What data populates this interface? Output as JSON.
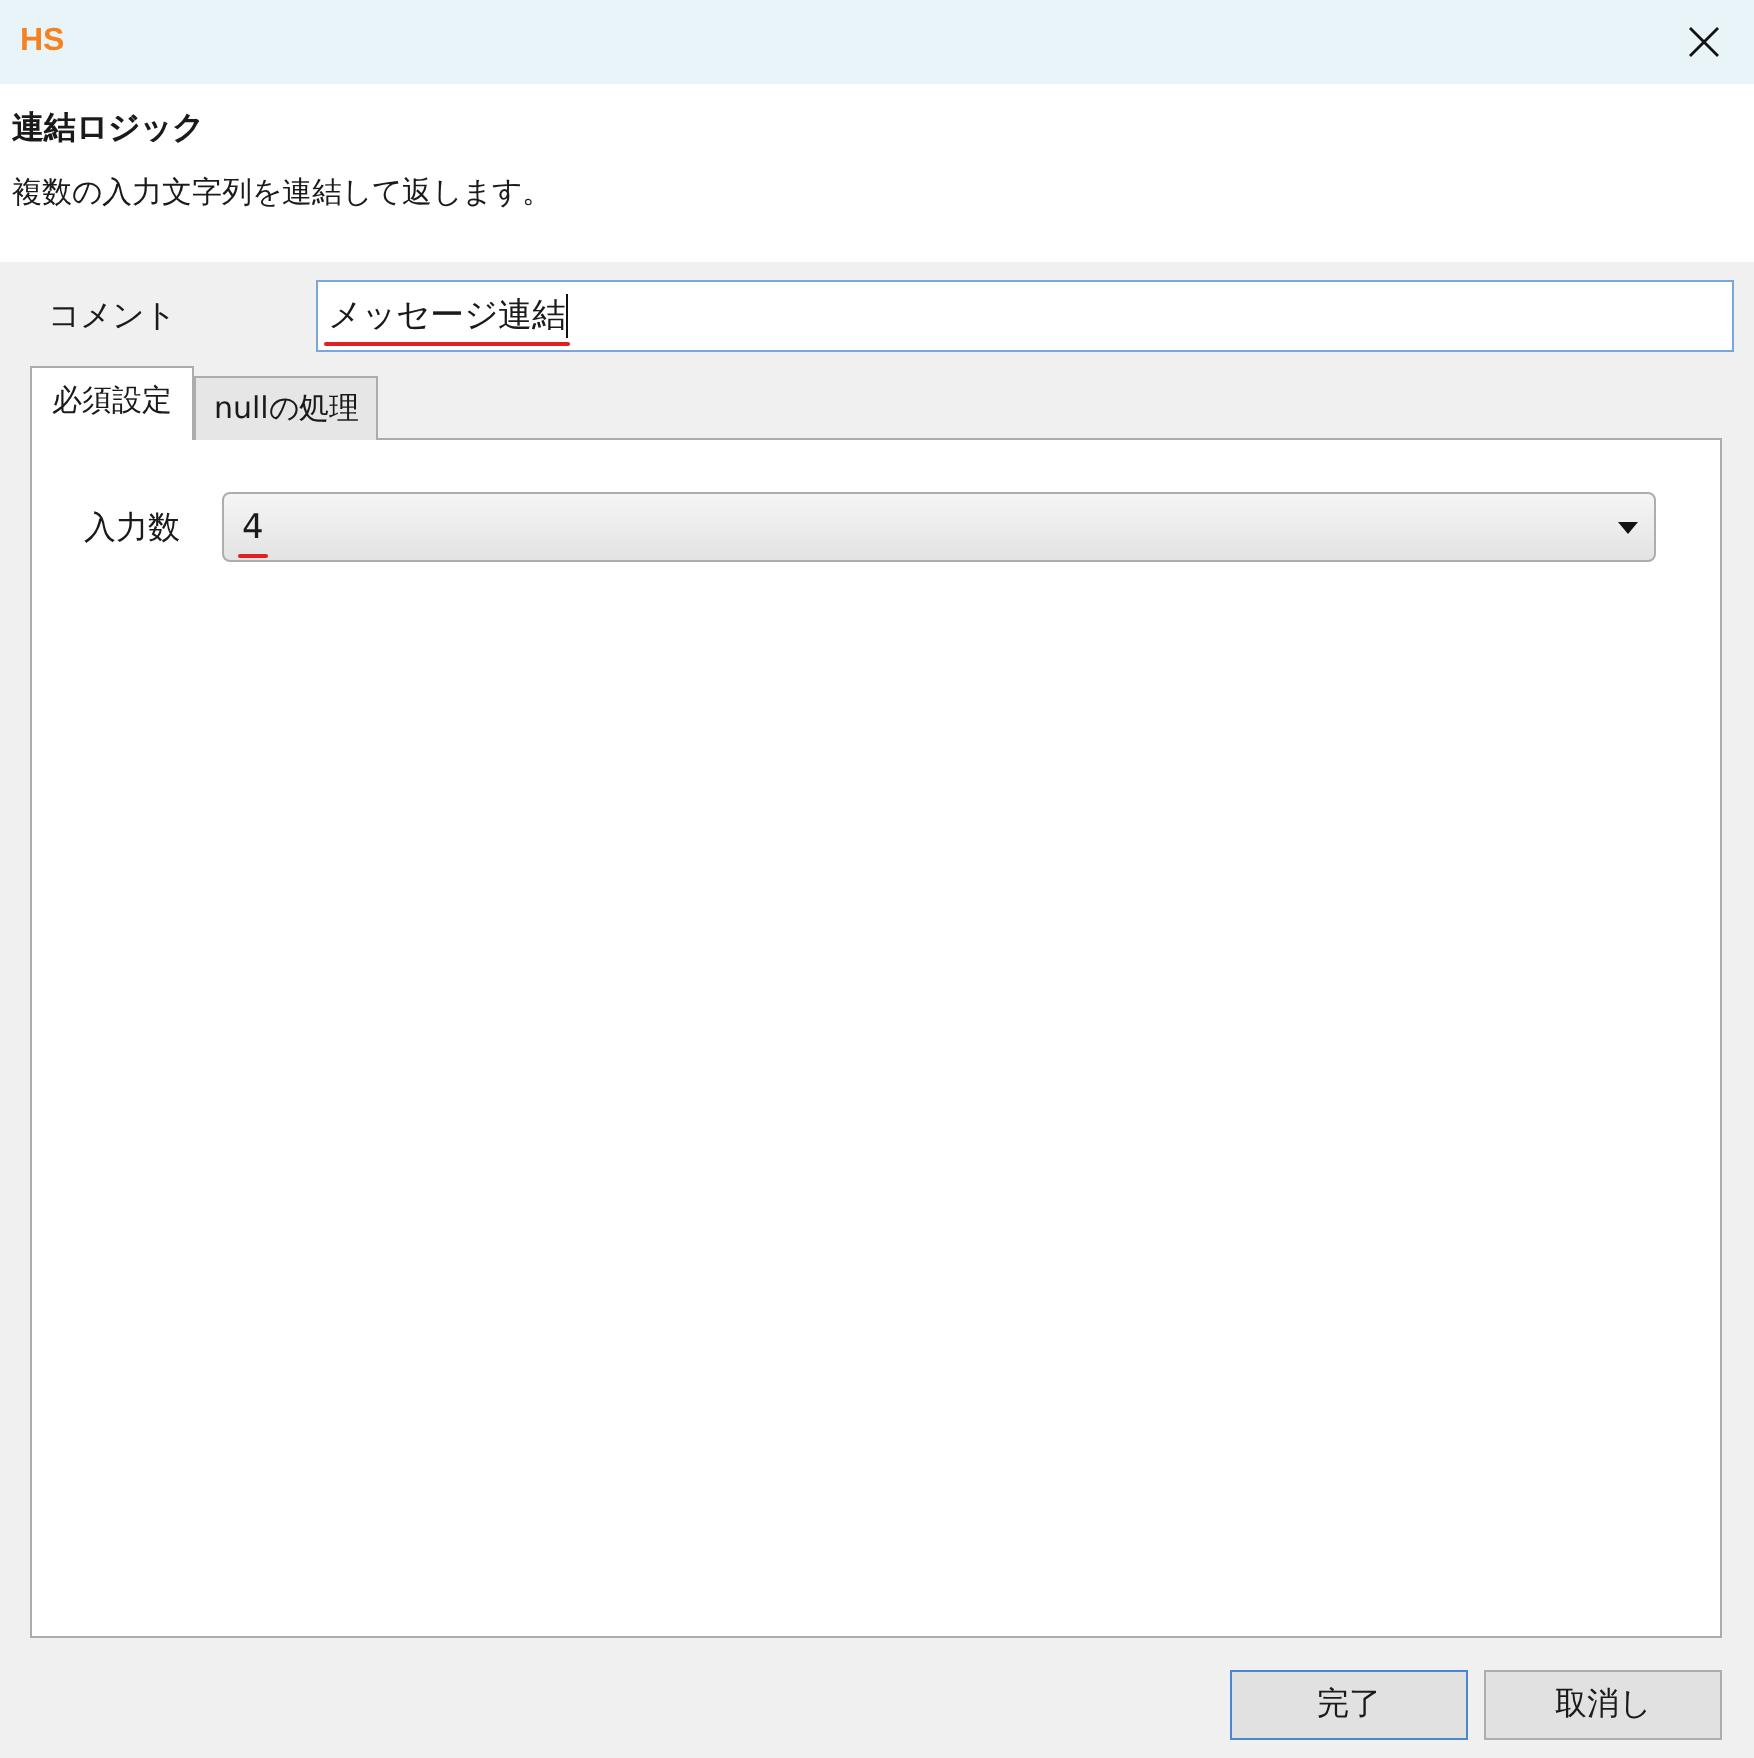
{
  "window": {
    "logo": "HS"
  },
  "header": {
    "title": "連結ロジック",
    "description": "複数の入力文字列を連結して返します。"
  },
  "comment": {
    "label": "コメント",
    "value": "メッセージ連結",
    "focused": true,
    "annotated": true
  },
  "tabs": [
    {
      "label": "必須設定",
      "selected": true
    },
    {
      "label": "nullの処理",
      "selected": false
    }
  ],
  "fields": [
    {
      "kind": "dropdown",
      "label": "入力数",
      "value": "4",
      "annotated": true
    }
  ],
  "buttons": [
    {
      "label": "完了",
      "default": true
    },
    {
      "label": "取消し",
      "default": false
    }
  ]
}
